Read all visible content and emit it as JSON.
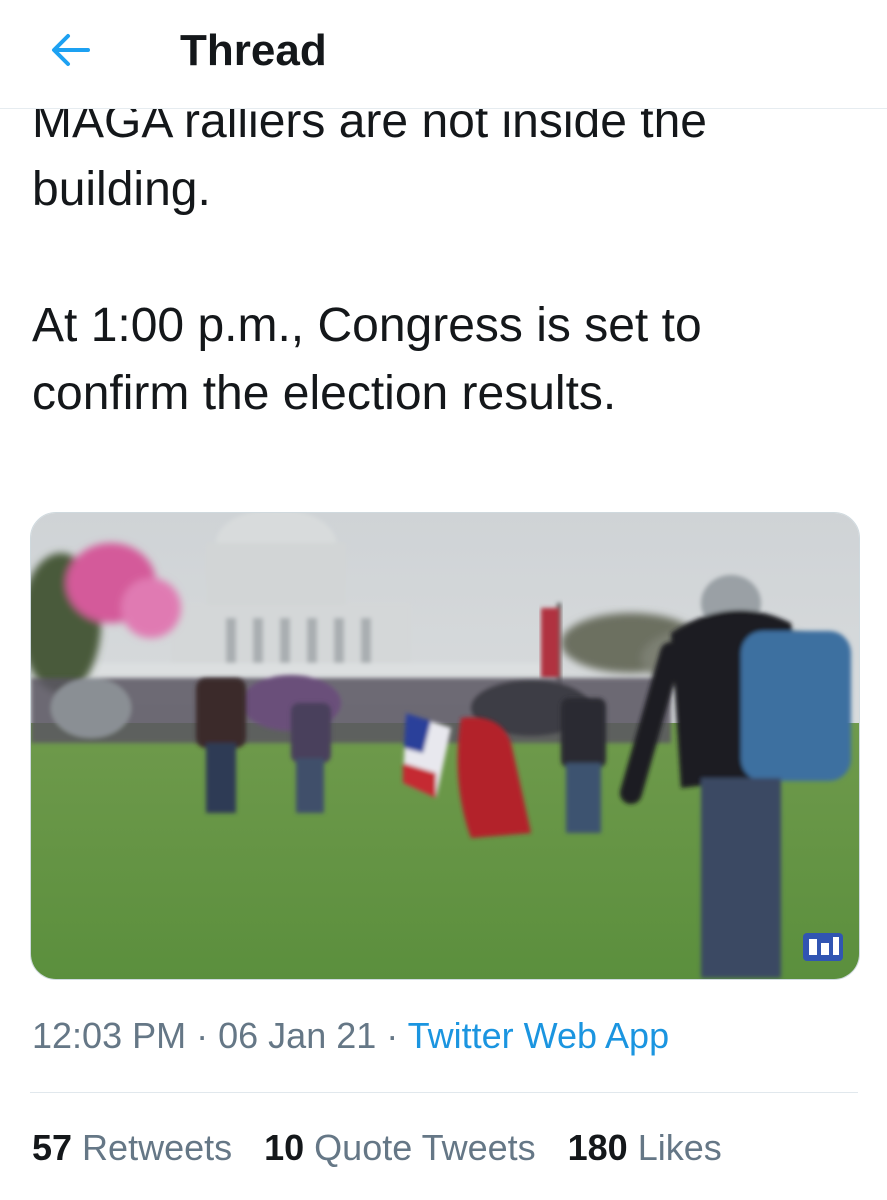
{
  "header": {
    "title": "Thread",
    "back_icon": "back-arrow-icon",
    "accent_color": "#1da1f2"
  },
  "tweet": {
    "text": "MAGA ralliers are not inside the\nbuilding.\n\nAt 1:00 p.m., Congress is set to\nconfirm the election results.",
    "media": {
      "type": "video-thumbnail",
      "watermark_icon": "channel-logo-icon"
    },
    "time": "12:03 PM",
    "separator": "·",
    "date": "06 Jan 21",
    "source": "Twitter Web App",
    "source_color": "#1b95e0"
  },
  "stats": {
    "retweets_count": "57",
    "retweets_label": "Retweets",
    "quotes_count": "10",
    "quotes_label": "Quote Tweets",
    "likes_count": "180",
    "likes_label": "Likes"
  }
}
